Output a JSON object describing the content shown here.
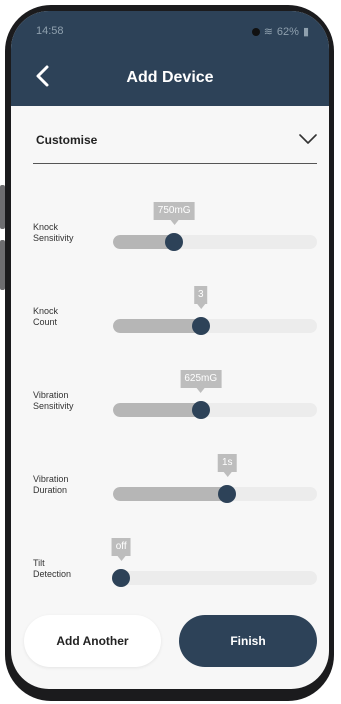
{
  "status_bar": {
    "time": "14:58",
    "battery": "62%"
  },
  "header": {
    "title": "Add Device"
  },
  "section": {
    "label": "Customise"
  },
  "sliders": [
    {
      "label_line1": "Knock",
      "label_line2": "Sensitivity",
      "value": "750mG",
      "fraction": 0.3
    },
    {
      "label_line1": "Knock",
      "label_line2": "Count",
      "value": "3",
      "fraction": 0.43
    },
    {
      "label_line1": "Vibration",
      "label_line2": "Sensitivity",
      "value": "625mG",
      "fraction": 0.43
    },
    {
      "label_line1": "Vibration",
      "label_line2": "Duration",
      "value": "1s",
      "fraction": 0.56
    },
    {
      "label_line1": "Tilt",
      "label_line2": "Detection",
      "value": "off",
      "fraction": 0.04
    }
  ],
  "buttons": {
    "add_another": "Add Another",
    "finish": "Finish"
  },
  "colors": {
    "primary": "#2d4258",
    "track": "#ececec",
    "fill": "#b6b6b6",
    "tag": "#bdbdbd"
  },
  "icons": {
    "back": "chevron-left-icon",
    "expand": "chevron-down-icon"
  }
}
